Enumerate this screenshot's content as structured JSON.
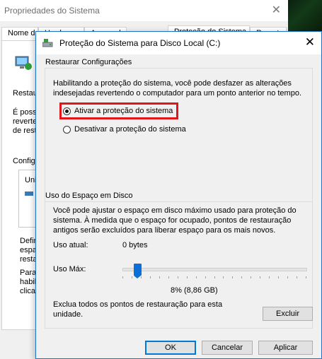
{
  "background_window": {
    "title": "Propriedades do Sistema",
    "tabs": [
      "Nome do Computador",
      "Hardware",
      "Avançado",
      "Proteção do Sistema",
      "Remoto"
    ],
    "fragments": [
      "Restau",
      "É poss",
      "reverte",
      "de resta",
      "Configu",
      "Uni",
      "Defin",
      "espa",
      "resta",
      "Para",
      "habili",
      "clicar"
    ]
  },
  "dialog": {
    "title": "Proteção do Sistema para Disco Local (C:)",
    "restore_section": {
      "label": "Restaurar Configurações",
      "description": "Habilitando a proteção do sistema, você pode desfazer as alterações indesejadas revertendo o computador para um ponto anterior no tempo.",
      "options": [
        {
          "label": "Ativar a proteção do sistema",
          "checked": true
        },
        {
          "label": "Desativar a proteção do sistema",
          "checked": false
        }
      ]
    },
    "disk_section": {
      "label": "Uso do Espaço em Disco",
      "description": "Você pode ajustar o espaço em disco máximo usado para proteção do sistema. À medida que o espaço for ocupado, pontos de restauração antigos serão excluídos para liberar espaço para os mais novos.",
      "current_usage_label": "Uso atual:",
      "current_usage_value": "0 bytes",
      "max_usage_label": "Uso Máx:",
      "slider_fraction": 0.08,
      "max_usage_value": "8% (8,86 GB)",
      "delete_text": "Exclua todos os pontos de restauração para esta unidade.",
      "delete_button": "Excluir"
    },
    "buttons": {
      "ok": "OK",
      "cancel": "Cancelar",
      "apply": "Aplicar"
    },
    "highlight_color": "#e0161a",
    "accent_color": "#0a6fd6"
  }
}
